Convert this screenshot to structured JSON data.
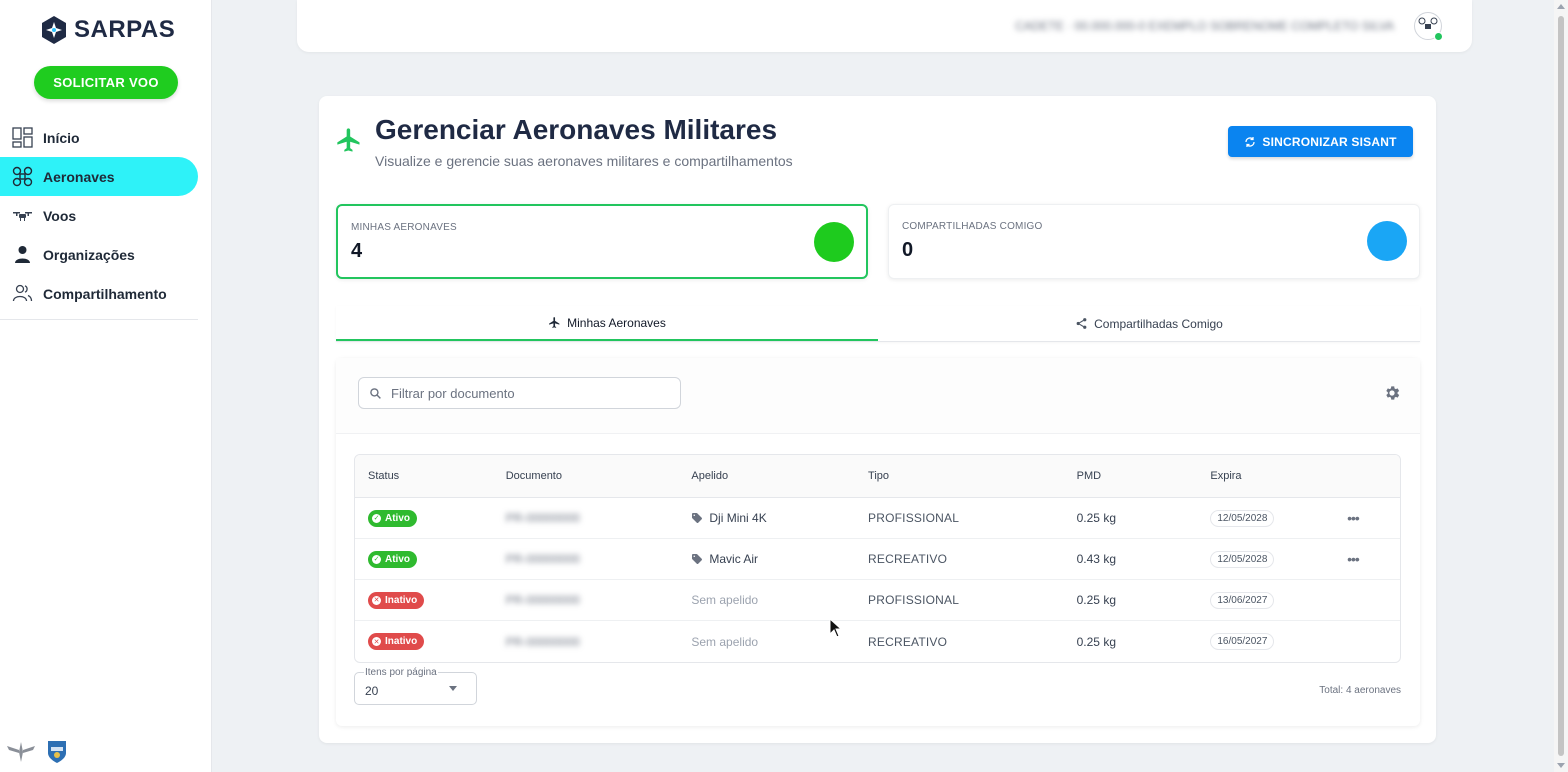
{
  "brand": {
    "name": "SARPAS"
  },
  "sidebar": {
    "cta_label": "SOLICITAR VOO",
    "items": [
      {
        "label": "Início",
        "icon": "dashboard-icon",
        "active": false
      },
      {
        "label": "Aeronaves",
        "icon": "drone-icon",
        "active": true
      },
      {
        "label": "Voos",
        "icon": "quadcopter-icon",
        "active": false
      },
      {
        "label": "Organizações",
        "icon": "person-icon",
        "active": false
      },
      {
        "label": "Compartilhamento",
        "icon": "people-icon",
        "active": false
      }
    ]
  },
  "header": {
    "user_text": "CADETE · 00.000.000-0 EXEMPLO SOBRENOME COMPLETO SILVA"
  },
  "page": {
    "title": "Gerenciar Aeronaves Militares",
    "subtitle": "Visualize e gerencie suas aeronaves militares e compartilhamentos",
    "sync_label": "SINCRONIZAR SISANT"
  },
  "stats": {
    "mine": {
      "label": "MINHAS AERONAVES",
      "value": "4",
      "color": "#1ecb1e"
    },
    "shared": {
      "label": "COMPARTILHADAS COMIGO",
      "value": "0",
      "color": "#1aa6f5"
    }
  },
  "tabs": [
    {
      "label": "Minhas Aeronaves",
      "icon": "plane-icon",
      "active": true
    },
    {
      "label": "Compartilhadas Comigo",
      "icon": "share-icon",
      "active": false
    }
  ],
  "filter": {
    "placeholder": "Filtrar por documento"
  },
  "table": {
    "columns": [
      "Status",
      "Documento",
      "Apelido",
      "Tipo",
      "PMD",
      "Expira"
    ],
    "rows": [
      {
        "status": "Ativo",
        "active": true,
        "documento": "PR-00000000",
        "apelido": "Dji Mini 4K",
        "has_nick": true,
        "tipo": "PROFISSIONAL",
        "pmd": "0.25 kg",
        "expira": "12/05/2028",
        "more": true
      },
      {
        "status": "Ativo",
        "active": true,
        "documento": "PR-00000000",
        "apelido": "Mavic Air",
        "has_nick": true,
        "tipo": "RECREATIVO",
        "pmd": "0.43 kg",
        "expira": "12/05/2028",
        "more": true
      },
      {
        "status": "Inativo",
        "active": false,
        "documento": "PR-00000000",
        "apelido": "Sem apelido",
        "has_nick": false,
        "tipo": "PROFISSIONAL",
        "pmd": "0.25 kg",
        "expira": "13/06/2027",
        "more": false
      },
      {
        "status": "Inativo",
        "active": false,
        "documento": "PR-00000000",
        "apelido": "Sem apelido",
        "has_nick": false,
        "tipo": "RECREATIVO",
        "pmd": "0.25 kg",
        "expira": "16/05/2027",
        "more": false
      }
    ]
  },
  "pagination": {
    "per_page_label": "Itens por página",
    "per_page_value": "20",
    "total": "Total: 4 aeronaves"
  },
  "colors": {
    "accent_green": "#1fcc1f",
    "active_nav": "#2ef2f8",
    "primary_blue": "#0a84f0",
    "badge_on": "#2fba2f",
    "badge_off": "#e04b4b"
  }
}
